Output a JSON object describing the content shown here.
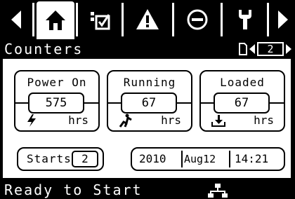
{
  "tabs": [
    {
      "name": "prev-arrow-icon"
    },
    {
      "name": "home-icon",
      "active": true
    },
    {
      "name": "checklist-icon"
    },
    {
      "name": "warning-icon"
    },
    {
      "name": "stop-icon"
    },
    {
      "name": "wrench-icon"
    },
    {
      "name": "next-arrow-icon"
    }
  ],
  "header": {
    "title": "Counters",
    "page": "2"
  },
  "counters": [
    {
      "label": "Power On",
      "value": "575",
      "unit": "hrs",
      "icon": "lightning-icon"
    },
    {
      "label": "Running",
      "value": "67",
      "unit": "hrs",
      "icon": "running-motor-icon"
    },
    {
      "label": "Loaded",
      "value": "67",
      "unit": "hrs",
      "icon": "load-icon"
    }
  ],
  "starts": {
    "label": "Starts",
    "value": "2"
  },
  "datetime": {
    "year": "2010",
    "date": "Aug12",
    "time": "14:21"
  },
  "status": {
    "text": "Ready to Start",
    "icon": "network-icon"
  },
  "colors": {
    "background": "#000000",
    "panel": "#ffffff",
    "foreground": "#ffffff"
  }
}
